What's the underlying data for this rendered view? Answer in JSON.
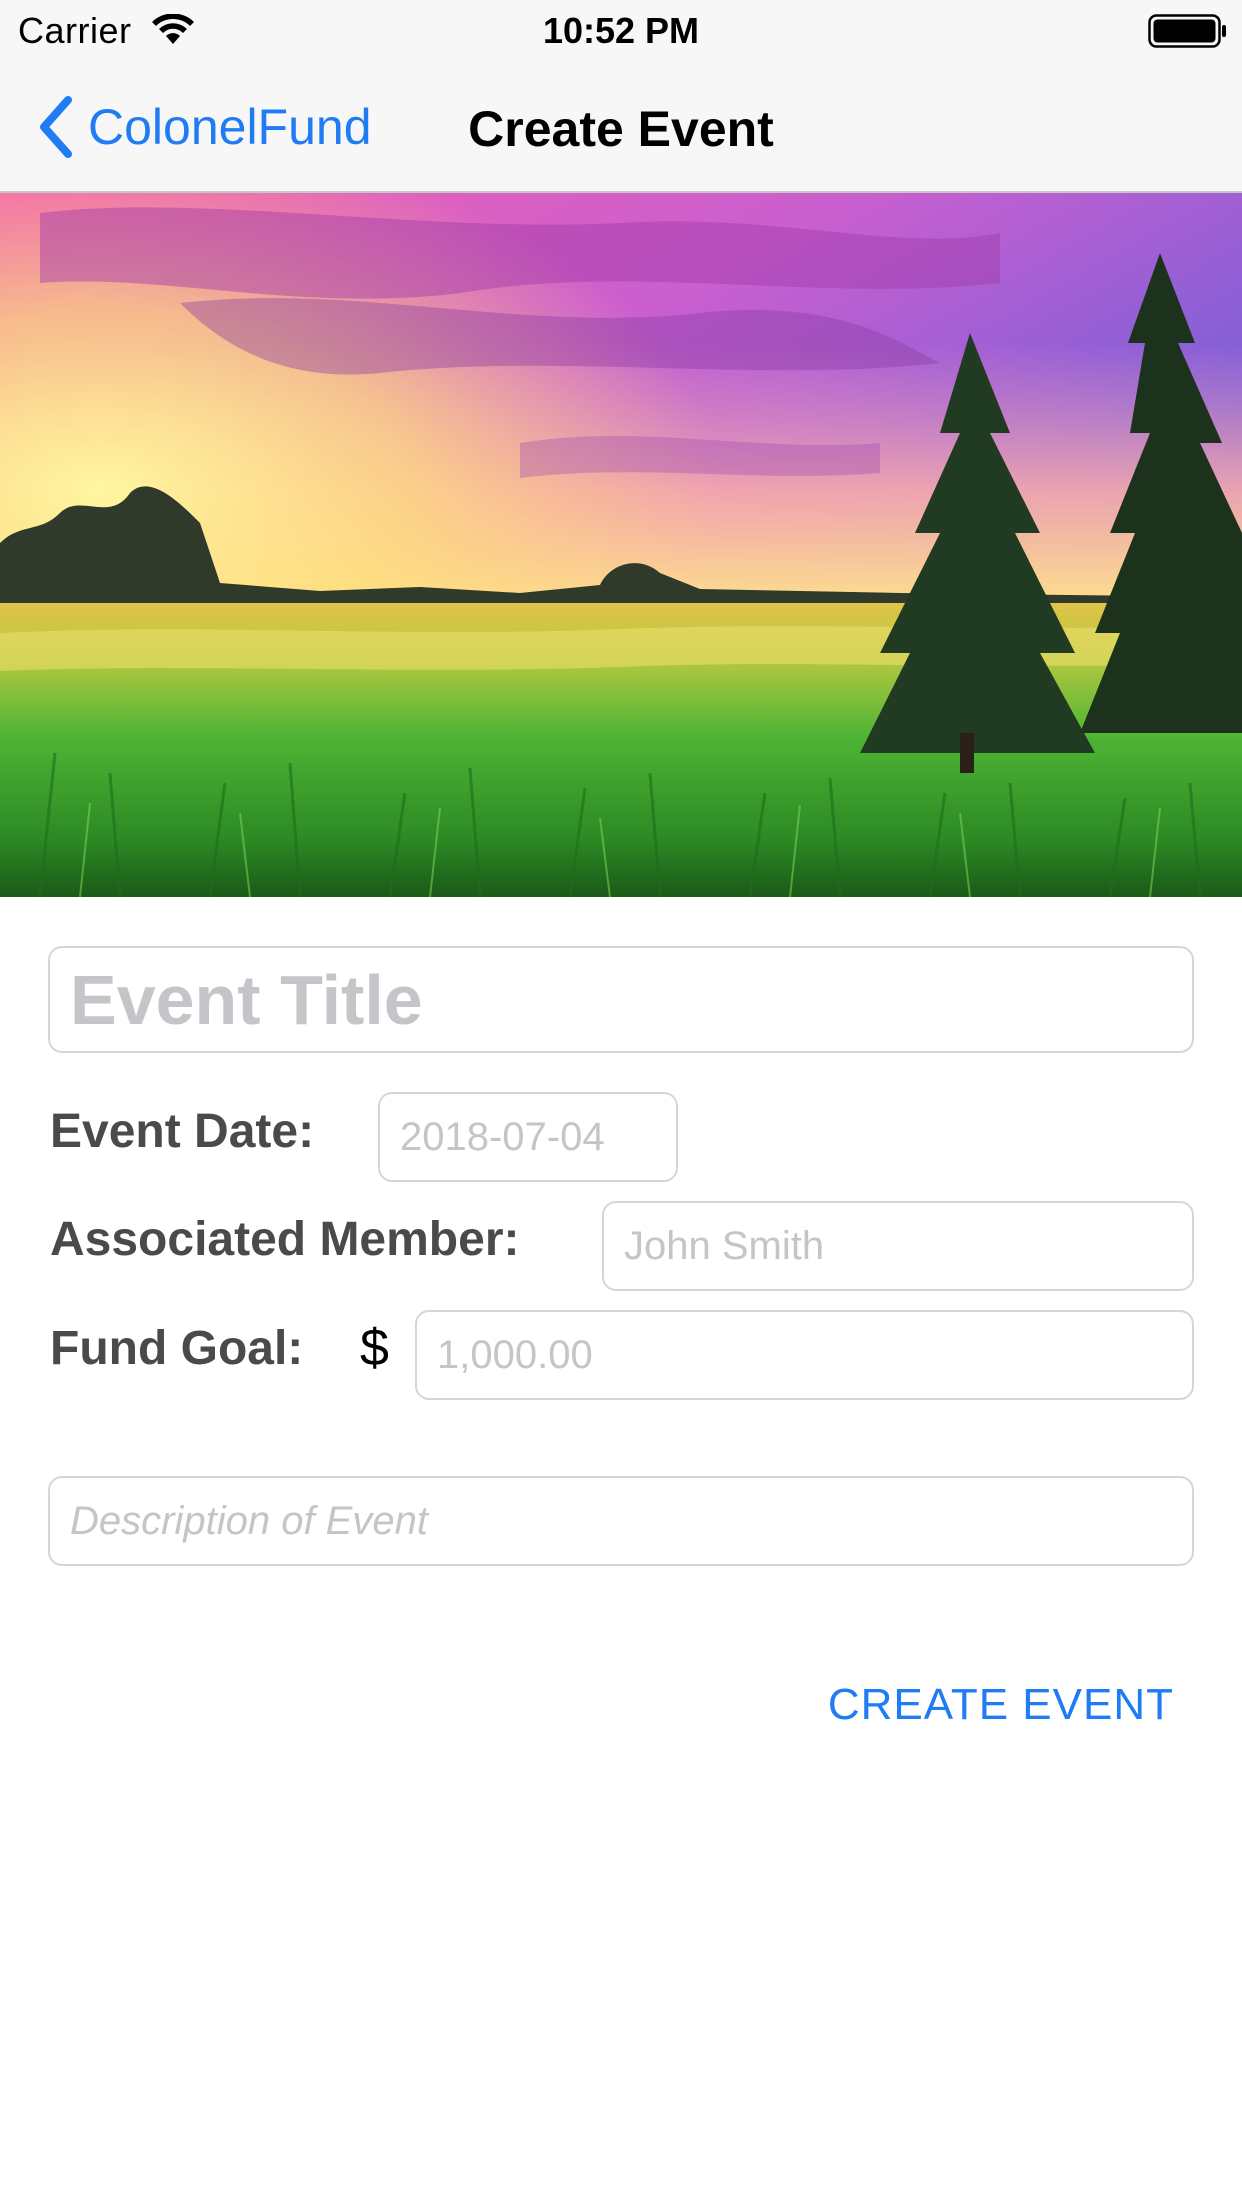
{
  "status_bar": {
    "carrier": "Carrier",
    "time": "10:52 PM",
    "wifi_icon": "wifi-icon",
    "battery_icon": "battery-full-icon"
  },
  "nav": {
    "back_label": "ColonelFund",
    "back_icon": "chevron-left-icon",
    "title": "Create Event"
  },
  "hero_image": {
    "subject": "landscape photo: colorful sunset sky over a green field with pine trees"
  },
  "form": {
    "title_placeholder": "Event Title",
    "date_label": "Event Date:",
    "date_placeholder": "2018-07-04",
    "member_label": "Associated Member:",
    "member_placeholder": "John Smith",
    "goal_label": "Fund Goal:",
    "currency_symbol": "$",
    "goal_placeholder": "1,000.00",
    "description_placeholder": "Description of Event"
  },
  "actions": {
    "create_label": "CREATE EVENT"
  },
  "colors": {
    "accent": "#1f7cf4",
    "label_text": "#4a4a4a",
    "placeholder_text": "#c4c4c9",
    "field_border": "#d6d6d6",
    "bar_background": "#f7f7f7"
  }
}
